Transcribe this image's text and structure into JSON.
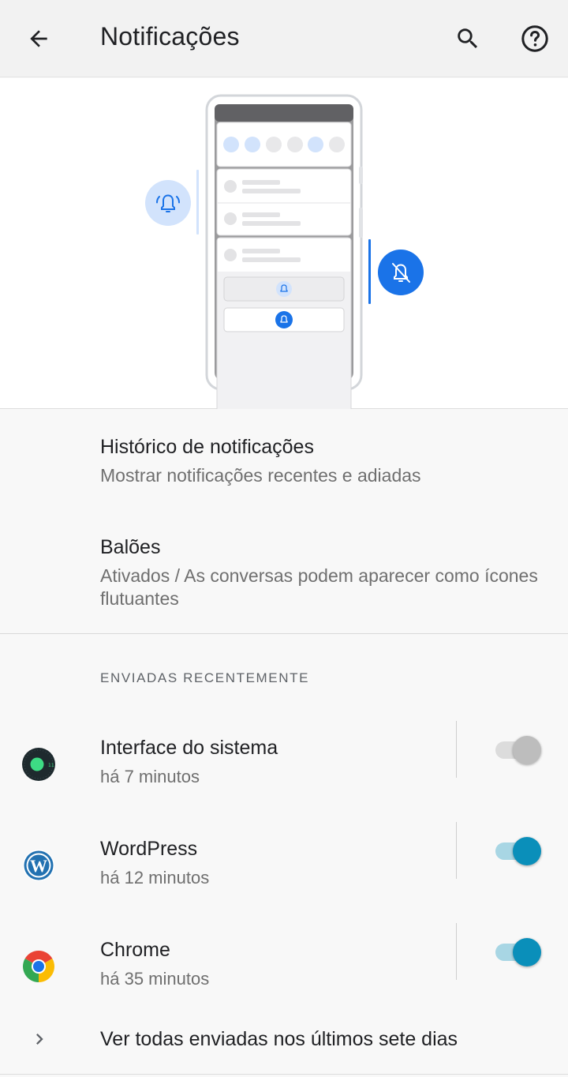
{
  "app_bar": {
    "title": "Notificações",
    "back_icon": "arrow-back-icon",
    "search_icon": "search-icon",
    "help_icon": "help-circle-icon"
  },
  "hero": {
    "illustration": "notifications-phone-illustration",
    "bell_icon": "bell-ring-icon",
    "bell_off_icon": "bell-off-icon"
  },
  "preferences": [
    {
      "title": "Histórico de notificações",
      "summary": "Mostrar notificações recentes e adiadas"
    },
    {
      "title": "Balões",
      "summary": "Ativados / As conversas podem aparecer como ícones flutuantes"
    }
  ],
  "recent": {
    "header": "ENVIADAS RECENTEMENTE",
    "apps": [
      {
        "name": "Interface do sistema",
        "time": "há 7 minutos",
        "enabled": false,
        "icon": "android-system-icon"
      },
      {
        "name": "WordPress",
        "time": "há 12 minutos",
        "enabled": true,
        "icon": "wordpress-icon"
      },
      {
        "name": "Chrome",
        "time": "há 35 minutos",
        "enabled": true,
        "icon": "chrome-icon"
      }
    ],
    "see_all": "Ver todas enviadas nos últimos sete dias",
    "see_all_icon": "chevron-right-icon"
  },
  "colors": {
    "accent": "#0a8fba",
    "toggle_track_on": "#a8d6e4",
    "illustration_blue": "#1a73e8",
    "illustration_light_blue": "#d2e3fc"
  }
}
